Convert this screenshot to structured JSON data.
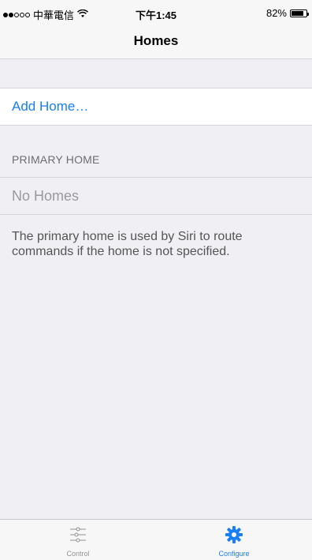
{
  "status_bar": {
    "carrier": "中華電信",
    "time": "下午1:45",
    "battery_percent_text": "82%",
    "battery_level": 0.82,
    "signal_bars_filled": 2,
    "signal_bars_total": 5
  },
  "nav": {
    "title": "Homes"
  },
  "add_home": {
    "label": "Add Home…"
  },
  "primary_section": {
    "header": "PRIMARY HOME",
    "empty_label": "No Homes",
    "footer": "The primary home is used by Siri to route commands if the home is not specified."
  },
  "tab_bar": {
    "tabs": [
      {
        "label": "Control",
        "icon": "sliders-icon",
        "active": false
      },
      {
        "label": "Configure",
        "icon": "gear-icon",
        "active": true
      }
    ]
  },
  "colors": {
    "accent": "#1a7ef5",
    "background": "#efeff4",
    "inactive": "#929292"
  }
}
